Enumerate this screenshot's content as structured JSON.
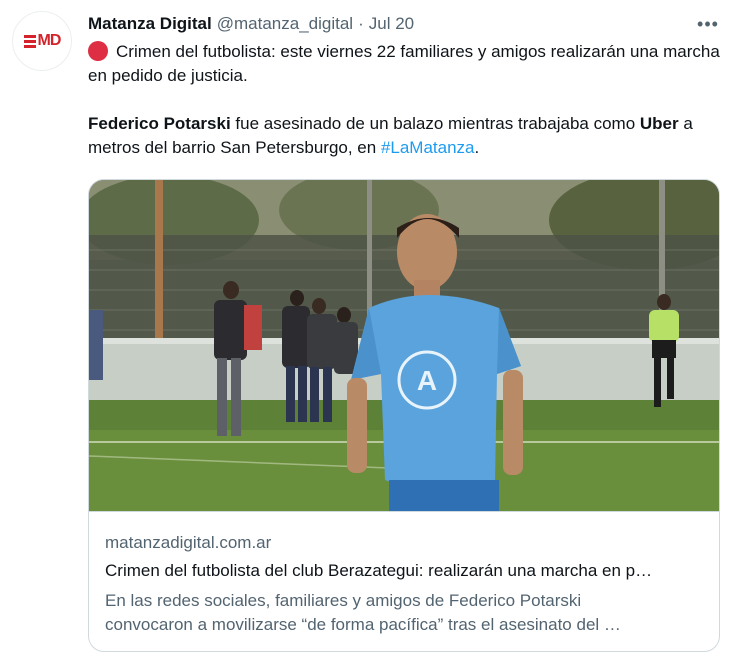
{
  "tweet": {
    "author_name": "Matanza Digital",
    "author_handle": "@matanza_digital",
    "separator": "·",
    "date": "Jul 20",
    "more_icon": "more-horizontal-icon",
    "avatar_text": "MD",
    "text_line1": "Crimen del futbolista: este viernes 22 familiares y amigos realizarán una marcha en pedido de justicia.",
    "p2_bold1": "Federico Potarski",
    "p2_text1": " fue asesinado de un balazo mientras trabajaba como ",
    "p2_bold2": "Uber",
    "p2_text2": " a metros del barrio San Petersburgo, en ",
    "p2_hashtag": "#LaMatanza",
    "p2_end": ".",
    "emoji": "red-circle-icon"
  },
  "card": {
    "domain": "matanzadigital.com.ar",
    "title": "Crimen del futbolista del club Berazategui: realizarán una marcha en p…",
    "desc_line1": "En las redes sociales, familiares y amigos de Federico Potarski",
    "desc_line2": "convocaron a movilizarse “de forma pacífica” tras el asesinato del …",
    "image_alt": "football-player-photo"
  },
  "colors": {
    "text": "#0f1419",
    "secondary": "#536471",
    "link": "#1d9bf0",
    "border": "#cfd9de",
    "emoji_red": "#dd2e44",
    "brand_red": "#d5232b"
  }
}
